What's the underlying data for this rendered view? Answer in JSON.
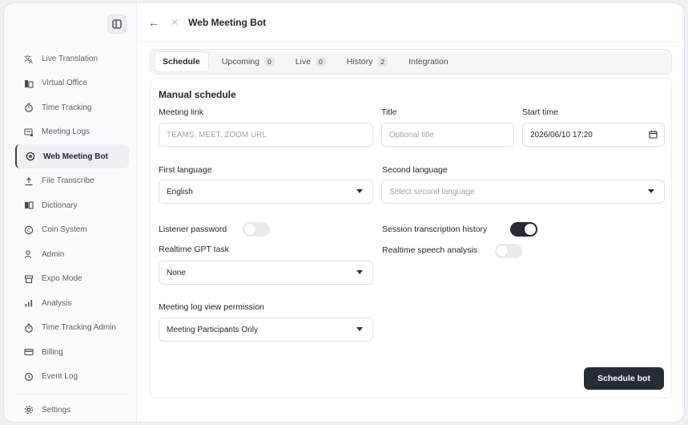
{
  "header": {
    "title": "Web Meeting Bot"
  },
  "sidebar": {
    "items": [
      {
        "label": "Live Translation",
        "icon": "translate-icon"
      },
      {
        "label": "Virtual Office",
        "icon": "office-icon"
      },
      {
        "label": "Time Tracking",
        "icon": "timer-icon"
      },
      {
        "label": "Meeting Logs",
        "icon": "logs-icon"
      },
      {
        "label": "Web Meeting Bot",
        "icon": "bot-icon",
        "active": true
      },
      {
        "label": "File Transcribe",
        "icon": "upload-icon"
      },
      {
        "label": "Dictionary",
        "icon": "dictionary-icon"
      },
      {
        "label": "Coin System",
        "icon": "coin-icon"
      },
      {
        "label": "Admin",
        "icon": "admin-icon"
      },
      {
        "label": "Expo Mode",
        "icon": "expo-icon"
      },
      {
        "label": "Analysis",
        "icon": "analysis-icon"
      },
      {
        "label": "Time Tracking Admin",
        "icon": "timer-icon"
      },
      {
        "label": "Billing",
        "icon": "card-icon"
      },
      {
        "label": "Event Log",
        "icon": "history-icon"
      }
    ],
    "settings_label": "Settings"
  },
  "tabs": [
    {
      "label": "Schedule",
      "badge": ""
    },
    {
      "label": "Upcoming",
      "badge": "0"
    },
    {
      "label": "Live",
      "badge": "0"
    },
    {
      "label": "History",
      "badge": "2"
    },
    {
      "label": "Integration",
      "badge": ""
    }
  ],
  "form": {
    "section_title": "Manual schedule",
    "meeting_link": {
      "label": "Meeting link",
      "placeholder": "TEAMS, MEET, ZOOM URL",
      "value": ""
    },
    "title": {
      "label": "Title",
      "placeholder": "Optional title",
      "value": ""
    },
    "start_time": {
      "label": "Start time",
      "value": "2026/06/10 17:20"
    },
    "first_language": {
      "label": "First language",
      "value": "English"
    },
    "second_language": {
      "label": "Second language",
      "placeholder": "Select second language"
    },
    "listener_password": {
      "label": "Listener password",
      "on": false
    },
    "session_history": {
      "label": "Session transcription history",
      "on": true
    },
    "gpt_task": {
      "label": "Realtime GPT task",
      "value": "None"
    },
    "speech_analysis": {
      "label": "Realtime speech analysis",
      "on": false
    },
    "log_permission": {
      "label": "Meeting log view permission",
      "value": "Meeting Participants Only"
    },
    "submit_label": "Schedule bot"
  }
}
